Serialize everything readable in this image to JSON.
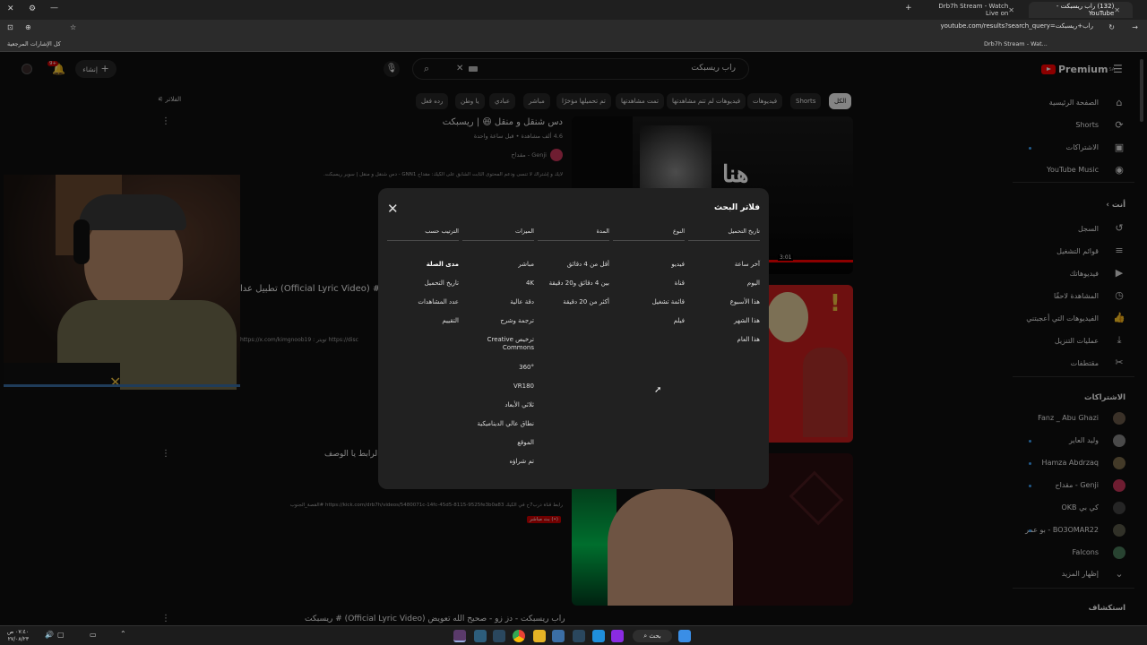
{
  "browser": {
    "tabs": [
      {
        "label": "(132) راب ريسبكت - YouTube",
        "active": true
      },
      {
        "label": "Drb7h Stream - Watch Live on",
        "active": false
      }
    ],
    "url": "youtube.com/results?search_query=راب+ريسبكت",
    "bookmarks_right": "Drb7h Stream - Wat...",
    "bookmarks_left": "كل الإشارات المرجعية"
  },
  "masthead": {
    "logo": "Premium",
    "logo_sup": "SA",
    "search_value": "راب ريسبكت",
    "create_label": "إنشاء",
    "notif_count": "9+"
  },
  "chips": [
    "الكل",
    "Shorts",
    "فيديوهات",
    "فيديوهات لم تتم مشاهدتها",
    "تمت مشاهدتها",
    "تم تحميلها مؤخرًا",
    "مباشر",
    "عبادي",
    "يا وطن",
    "رده فعل"
  ],
  "filters_label": "الفلاتر",
  "sidebar": {
    "main": [
      "الصفحة الرئيسية",
      "Shorts",
      "الاشتراكات",
      "YouTube Music"
    ],
    "you_head": "أنت",
    "you": [
      "السجل",
      "قوائم التشغيل",
      "فيديوهاتك",
      "المشاهدة لاحقًا",
      "الفيديوهات التي أعجبتني",
      "عمليات التنزيل",
      "مقتطفات"
    ],
    "subs_head": "الاشتراكات",
    "subs": [
      "Fanz _ Abu Ghazi",
      "وليد العاير",
      "Hamza Abdrzaq",
      "Genji - مقداح",
      "كي بي OKB",
      "BO3OMAR22 - بو عمر",
      "Falcons"
    ],
    "show_more": "إظهار المزيد",
    "explore_head": "استكشاف"
  },
  "results": [
    {
      "title": "دس شنقل و منقل 😆 | ريسبكت",
      "meta": "4.6 ألف مشاهدة • قبل ساعة واحدة",
      "channel": "Genji - مقداح",
      "desc": "لايك و إشتراك لا تنسى ودعم المحتوى الثابت الشابق على الكيك: مقداح GNN1 - دس شنقل و منقل | سوبر ريسبكت."
    },
    {
      "title": "تطبيل عدا (Official Lyric Video) #رو",
      "desc": "https://x.com/kimgnoob19 : تويتر https://disc"
    },
    {
      "title": "الرابط يا الوصف",
      "desc": "رابط قناة درب7ح في الكيك https://kick.com/drb7h/videos/5480071c-14fc-45d5-8115-9525fe3b0a83 #القصة_الجنوب",
      "badge": "(•) بث مباشر"
    },
    {
      "title": "راب ريسبكت - دز زو - صحيح الله تعويض (Official Lyric Video) # ريسبكت"
    }
  ],
  "thumb_text": {
    "hona": "هنا",
    "duration": "3:01"
  },
  "dialog": {
    "title": "فلاتر البحث",
    "columns": [
      {
        "header": "تاريخ التحميل",
        "options": [
          "آخر ساعة",
          "اليوم",
          "هذا الأسبوع",
          "هذا الشهر",
          "هذا العام"
        ]
      },
      {
        "header": "النوع",
        "options": [
          "فيديو",
          "قناة",
          "قائمة تشغيل",
          "فيلم"
        ]
      },
      {
        "header": "المدة",
        "options": [
          "أقل من 4 دقائق",
          "بين 4 دقائق و20 دقيقة",
          "أكثر من 20 دقيقة"
        ]
      },
      {
        "header": "الميزات",
        "options": [
          "مباشر",
          "4K",
          "دقة عالية",
          "ترجمة وشرح",
          "ترخيص Creative Commons",
          "360°",
          "VR180",
          "ثلاثي الأبعاد",
          "نطاق عالي الديناميكية",
          "الموقع",
          "تم شراؤه"
        ]
      },
      {
        "header": "الترتيب حسب",
        "options": [
          "مدى الصلة",
          "تاريخ التحميل",
          "عدد المشاهدات",
          "التقييم"
        ],
        "selected": 0
      }
    ]
  },
  "taskbar": {
    "search_label": "بحث",
    "time": "٠٧:٤٠ ص",
    "date": "٢٧/٠٨/٢٣"
  }
}
